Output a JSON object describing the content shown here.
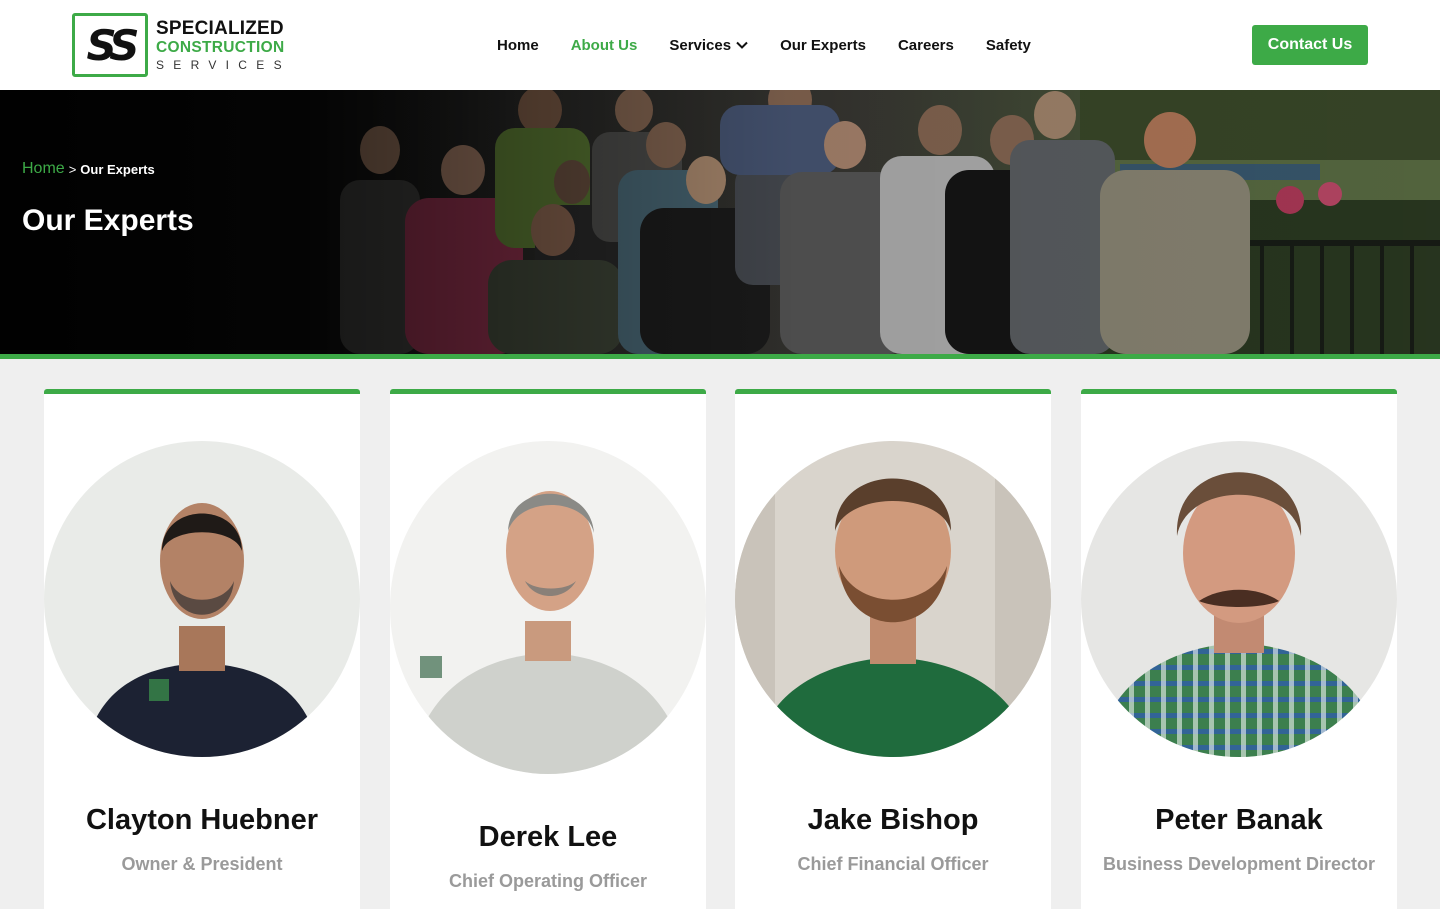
{
  "header": {
    "logo": {
      "mark": "SS",
      "line1": "SPECIALIZED",
      "line2": "CONSTRUCTION",
      "line3": "SERVICES"
    },
    "nav": [
      {
        "label": "Home",
        "active": false
      },
      {
        "label": "About Us",
        "active": true
      },
      {
        "label": "Services",
        "active": false,
        "has_dropdown": true
      },
      {
        "label": "Our Experts",
        "active": false
      },
      {
        "label": "Careers",
        "active": false
      },
      {
        "label": "Safety",
        "active": false
      }
    ],
    "cta_label": "Contact Us"
  },
  "hero": {
    "breadcrumb": {
      "home": "Home",
      "separator": ">",
      "current": "Our Experts"
    },
    "title": "Our Experts"
  },
  "team": [
    {
      "name": "Clayton Huebner",
      "role": "Owner & President",
      "shirt": "#1c2233",
      "bg": "#e9ebe8"
    },
    {
      "name": "Derek Lee",
      "role": "Chief Operating Officer",
      "shirt": "#cfd1cc",
      "bg": "#f2f2f0"
    },
    {
      "name": "Jake Bishop",
      "role": "Chief Financial Officer",
      "shirt": "#1f6b3d",
      "bg": "#d9d4cc"
    },
    {
      "name": "Peter Banak",
      "role": "Business Development Director",
      "shirt": "#3c7f4e",
      "bg": "#e6e6e4"
    }
  ],
  "colors": {
    "accent": "#3daa47",
    "text": "#111111",
    "muted": "#9a9a9a",
    "page_bg": "#efefef"
  }
}
